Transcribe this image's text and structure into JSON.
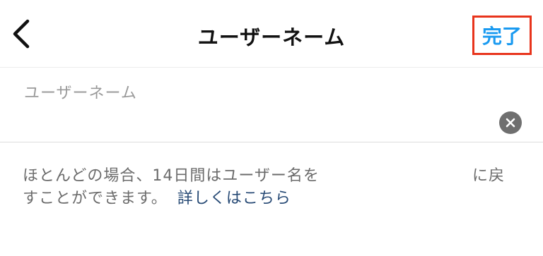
{
  "header": {
    "title": "ユーザーネーム",
    "done_label": "完了",
    "back_icon": "chevron-left-icon"
  },
  "username_field": {
    "label": "ユーザーネーム",
    "value": "",
    "clear_icon": "clear-circle-icon"
  },
  "help": {
    "line1": "ほとんどの場合、14日間はユーザー名を",
    "line1_tail": "に戻",
    "line2": "すことができます。",
    "link_label": "詳しくはこちら"
  },
  "colors": {
    "accent": "#1a9af0",
    "highlight_border": "#e8341c",
    "link": "#274a75"
  }
}
